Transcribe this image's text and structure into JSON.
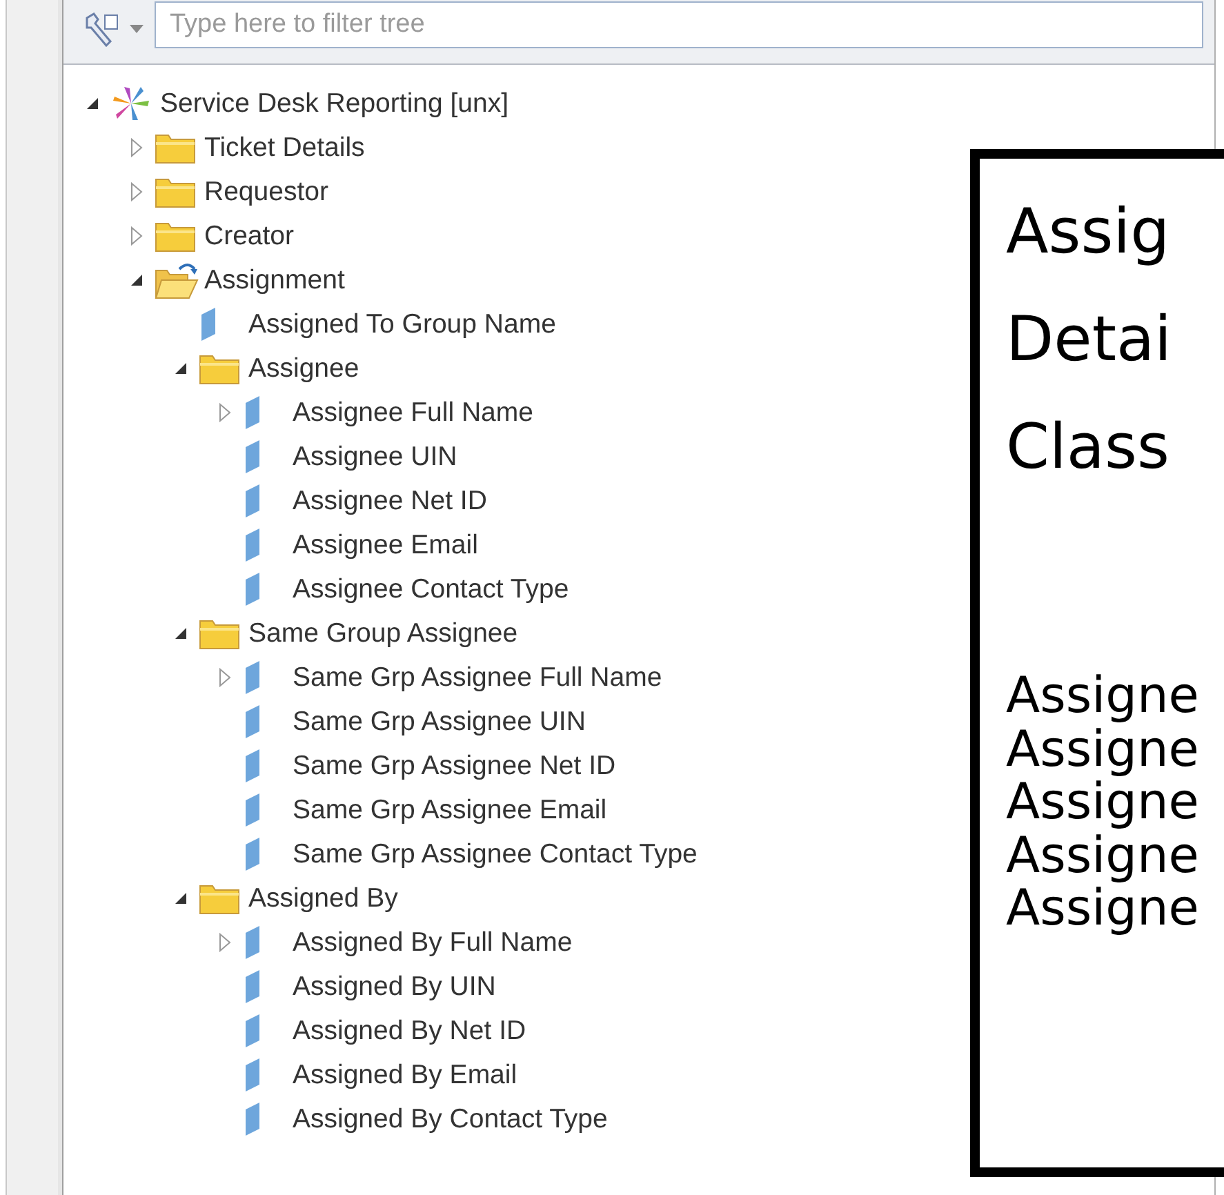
{
  "toolbar": {
    "filter": {
      "placeholder": "Type here to filter tree"
    }
  },
  "tree": [
    {
      "label": "Service Desk Reporting [unx]",
      "kind": "universe",
      "expanded": true,
      "children": [
        {
          "label": "Ticket Details",
          "kind": "folder",
          "expanded": false
        },
        {
          "label": "Requestor",
          "kind": "folder",
          "expanded": false
        },
        {
          "label": "Creator",
          "kind": "folder",
          "expanded": false
        },
        {
          "label": "Assignment",
          "kind": "open-folder",
          "expanded": true,
          "children": [
            {
              "label": "Assigned To Group Name",
              "kind": "field"
            },
            {
              "label": "Assignee",
              "kind": "folder",
              "expanded": true,
              "children": [
                {
                  "label": "Assignee Full Name",
                  "kind": "field",
                  "expanded": false
                },
                {
                  "label": "Assignee UIN",
                  "kind": "field"
                },
                {
                  "label": "Assignee Net ID",
                  "kind": "field"
                },
                {
                  "label": "Assignee Email",
                  "kind": "field"
                },
                {
                  "label": "Assignee Contact Type",
                  "kind": "field"
                }
              ]
            },
            {
              "label": "Same Group Assignee",
              "kind": "folder",
              "expanded": true,
              "children": [
                {
                  "label": "Same Grp Assignee Full Name",
                  "kind": "field",
                  "expanded": false
                },
                {
                  "label": "Same Grp Assignee UIN",
                  "kind": "field"
                },
                {
                  "label": "Same Grp Assignee Net ID",
                  "kind": "field"
                },
                {
                  "label": "Same Grp Assignee Email",
                  "kind": "field"
                },
                {
                  "label": "Same Grp Assignee Contact Type",
                  "kind": "field"
                }
              ]
            },
            {
              "label": "Assigned By",
              "kind": "folder",
              "expanded": true,
              "children": [
                {
                  "label": "Assigned By Full Name",
                  "kind": "field",
                  "expanded": false
                },
                {
                  "label": "Assigned By UIN",
                  "kind": "field"
                },
                {
                  "label": "Assigned By Net ID",
                  "kind": "field"
                },
                {
                  "label": "Assigned By Email",
                  "kind": "field"
                },
                {
                  "label": "Assigned By Contact Type",
                  "kind": "field"
                }
              ]
            }
          ]
        }
      ]
    }
  ],
  "callout": {
    "title_lines": [
      "Assig",
      "Detai",
      "Class"
    ],
    "lines": [
      "Assigne",
      "Assigne",
      "Assigne",
      "Assigne",
      "Assigne"
    ]
  }
}
